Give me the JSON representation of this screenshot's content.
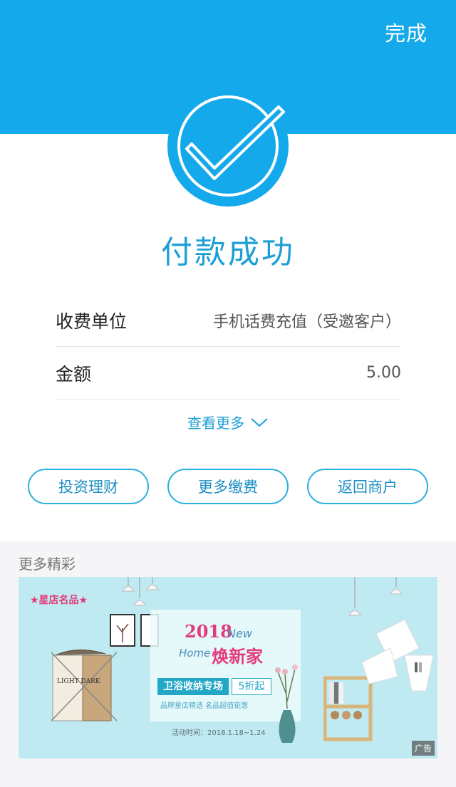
{
  "header": {
    "done_label": "完成"
  },
  "status": {
    "title": "付款成功"
  },
  "details": [
    {
      "label": "收费单位",
      "value": "手机话费充值（受邀客户）"
    },
    {
      "label": "金额",
      "value": "5.00"
    }
  ],
  "more_link": {
    "label": "查看更多"
  },
  "actions": [
    {
      "label": "投资理财"
    },
    {
      "label": "更多缴费"
    },
    {
      "label": "返回商户"
    }
  ],
  "section": {
    "title": "更多精彩"
  },
  "ad": {
    "badge": "★星店名品★",
    "year": "2018",
    "new": "New",
    "home": "Home",
    "slogan": "焕新家",
    "bar": "卫浴收纳专场",
    "discount": "5折起",
    "sub": "品牌星店精选 名品超值钜惠",
    "date": "活动时间：2018.1.18~1.24",
    "hamper_text": "LIGHT DARK",
    "tag": "广告"
  },
  "colors": {
    "accent": "#14a9ea",
    "title_blue": "#1d9fd6",
    "ad_pink": "#e33b7c"
  }
}
